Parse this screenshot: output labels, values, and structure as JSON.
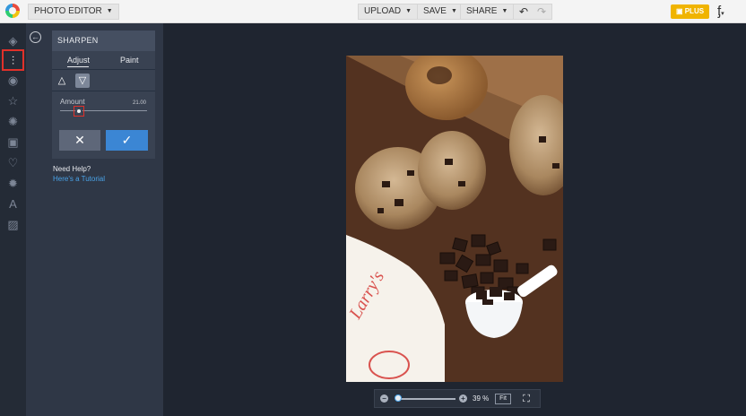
{
  "topbar": {
    "editor_label": "PHOTO EDITOR",
    "upload_label": "UPLOAD",
    "save_label": "SAVE",
    "share_label": "SHARE",
    "plus_label": "PLUS"
  },
  "iconbar": {
    "items": [
      "layers-icon",
      "adjust-icon",
      "eye-icon",
      "star-icon",
      "effects-icon",
      "frame-icon",
      "heart-icon",
      "badge-icon",
      "text-icon",
      "texture-icon"
    ],
    "active": "adjust-icon"
  },
  "panel": {
    "title": "SHARPEN",
    "tabs": [
      "Adjust",
      "Paint"
    ],
    "amount_label": "Amount",
    "amount_value": "21.00",
    "help_question": "Need Help?",
    "help_link": "Here's a Tutorial"
  },
  "zoom": {
    "value": "39 %",
    "fit_label": "Fit"
  },
  "colors": {
    "accent": "#3b86d4",
    "highlight": "#e0312a",
    "plus_badge": "#f0b400"
  }
}
